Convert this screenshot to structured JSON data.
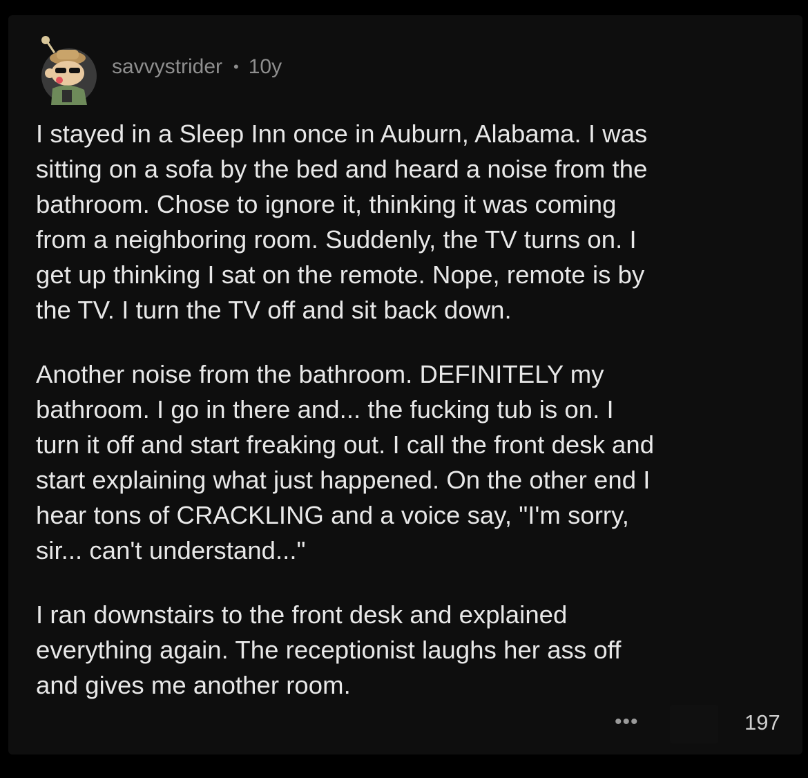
{
  "comment": {
    "author": "savvystrider",
    "separator": "•",
    "age": "10y",
    "paragraphs": [
      "I stayed in a Sleep Inn once in Auburn, Alabama. I was\nsitting on a sofa by the bed and heard a noise from the\nbathroom. Chose to ignore it, thinking it was coming\nfrom a neighboring room. Suddenly, the TV turns on. I\nget up thinking I sat on the remote. Nope, remote is by\nthe TV. I turn the TV off and sit back down.",
      "Another noise from the bathroom. DEFINITELY my\nbathroom. I go in there and... the fucking tub is on. I\nturn it off and start freaking out. I call the front desk and\nstart explaining what just happened. On the other end I\nhear tons of CRACKLING and a voice say, \"I'm sorry,\nsir... can't understand...\"",
      "I ran downstairs to the front desk and explained\neverything again. The receptionist laughs her ass off\nand gives me another room."
    ],
    "more_label": "•••",
    "vote_count": "197"
  },
  "icons": {
    "avatar": "snoo-avatar-icon",
    "more": "more-options-icon"
  },
  "colors": {
    "background": "#000000",
    "card": "#0e0e0e",
    "text": "#e8e8e8",
    "meta": "#8e8e8e"
  }
}
